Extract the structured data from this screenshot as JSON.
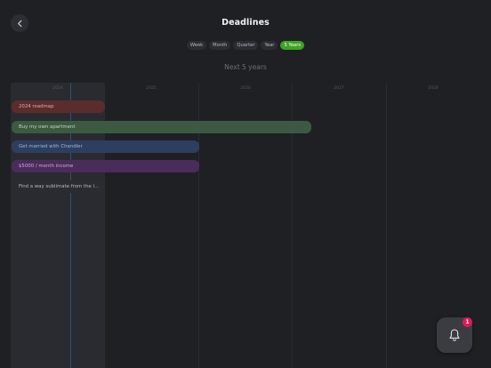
{
  "header": {
    "title": "Deadlines",
    "back_icon": "chevron-left-icon"
  },
  "range_tabs": [
    {
      "label": "Week",
      "active": false
    },
    {
      "label": "Month",
      "active": false
    },
    {
      "label": "Quarter",
      "active": false
    },
    {
      "label": "Year",
      "active": false
    },
    {
      "label": "5 Years",
      "active": true
    }
  ],
  "range_label": "Next 5 years",
  "timeline": {
    "years": [
      "2024",
      "2025",
      "2026",
      "2027",
      "2028"
    ],
    "goals": [
      {
        "label": "2024 roadmap",
        "color": "#5a2c2c"
      },
      {
        "label": "Buy my own apartment",
        "color": "#3c5a42"
      },
      {
        "label": "Get married with Chandler",
        "color": "#2d3f5e"
      },
      {
        "label": "$5000 / month income",
        "color": "#4a2c5a"
      },
      {
        "label": "Find a way sublimate from the last b...",
        "color": "#2b2c31"
      }
    ]
  },
  "notifications": {
    "icon": "bell-icon",
    "count": "1"
  },
  "colors": {
    "background": "#1f2024",
    "accent": "#3ea323",
    "badge": "#e2195b"
  }
}
